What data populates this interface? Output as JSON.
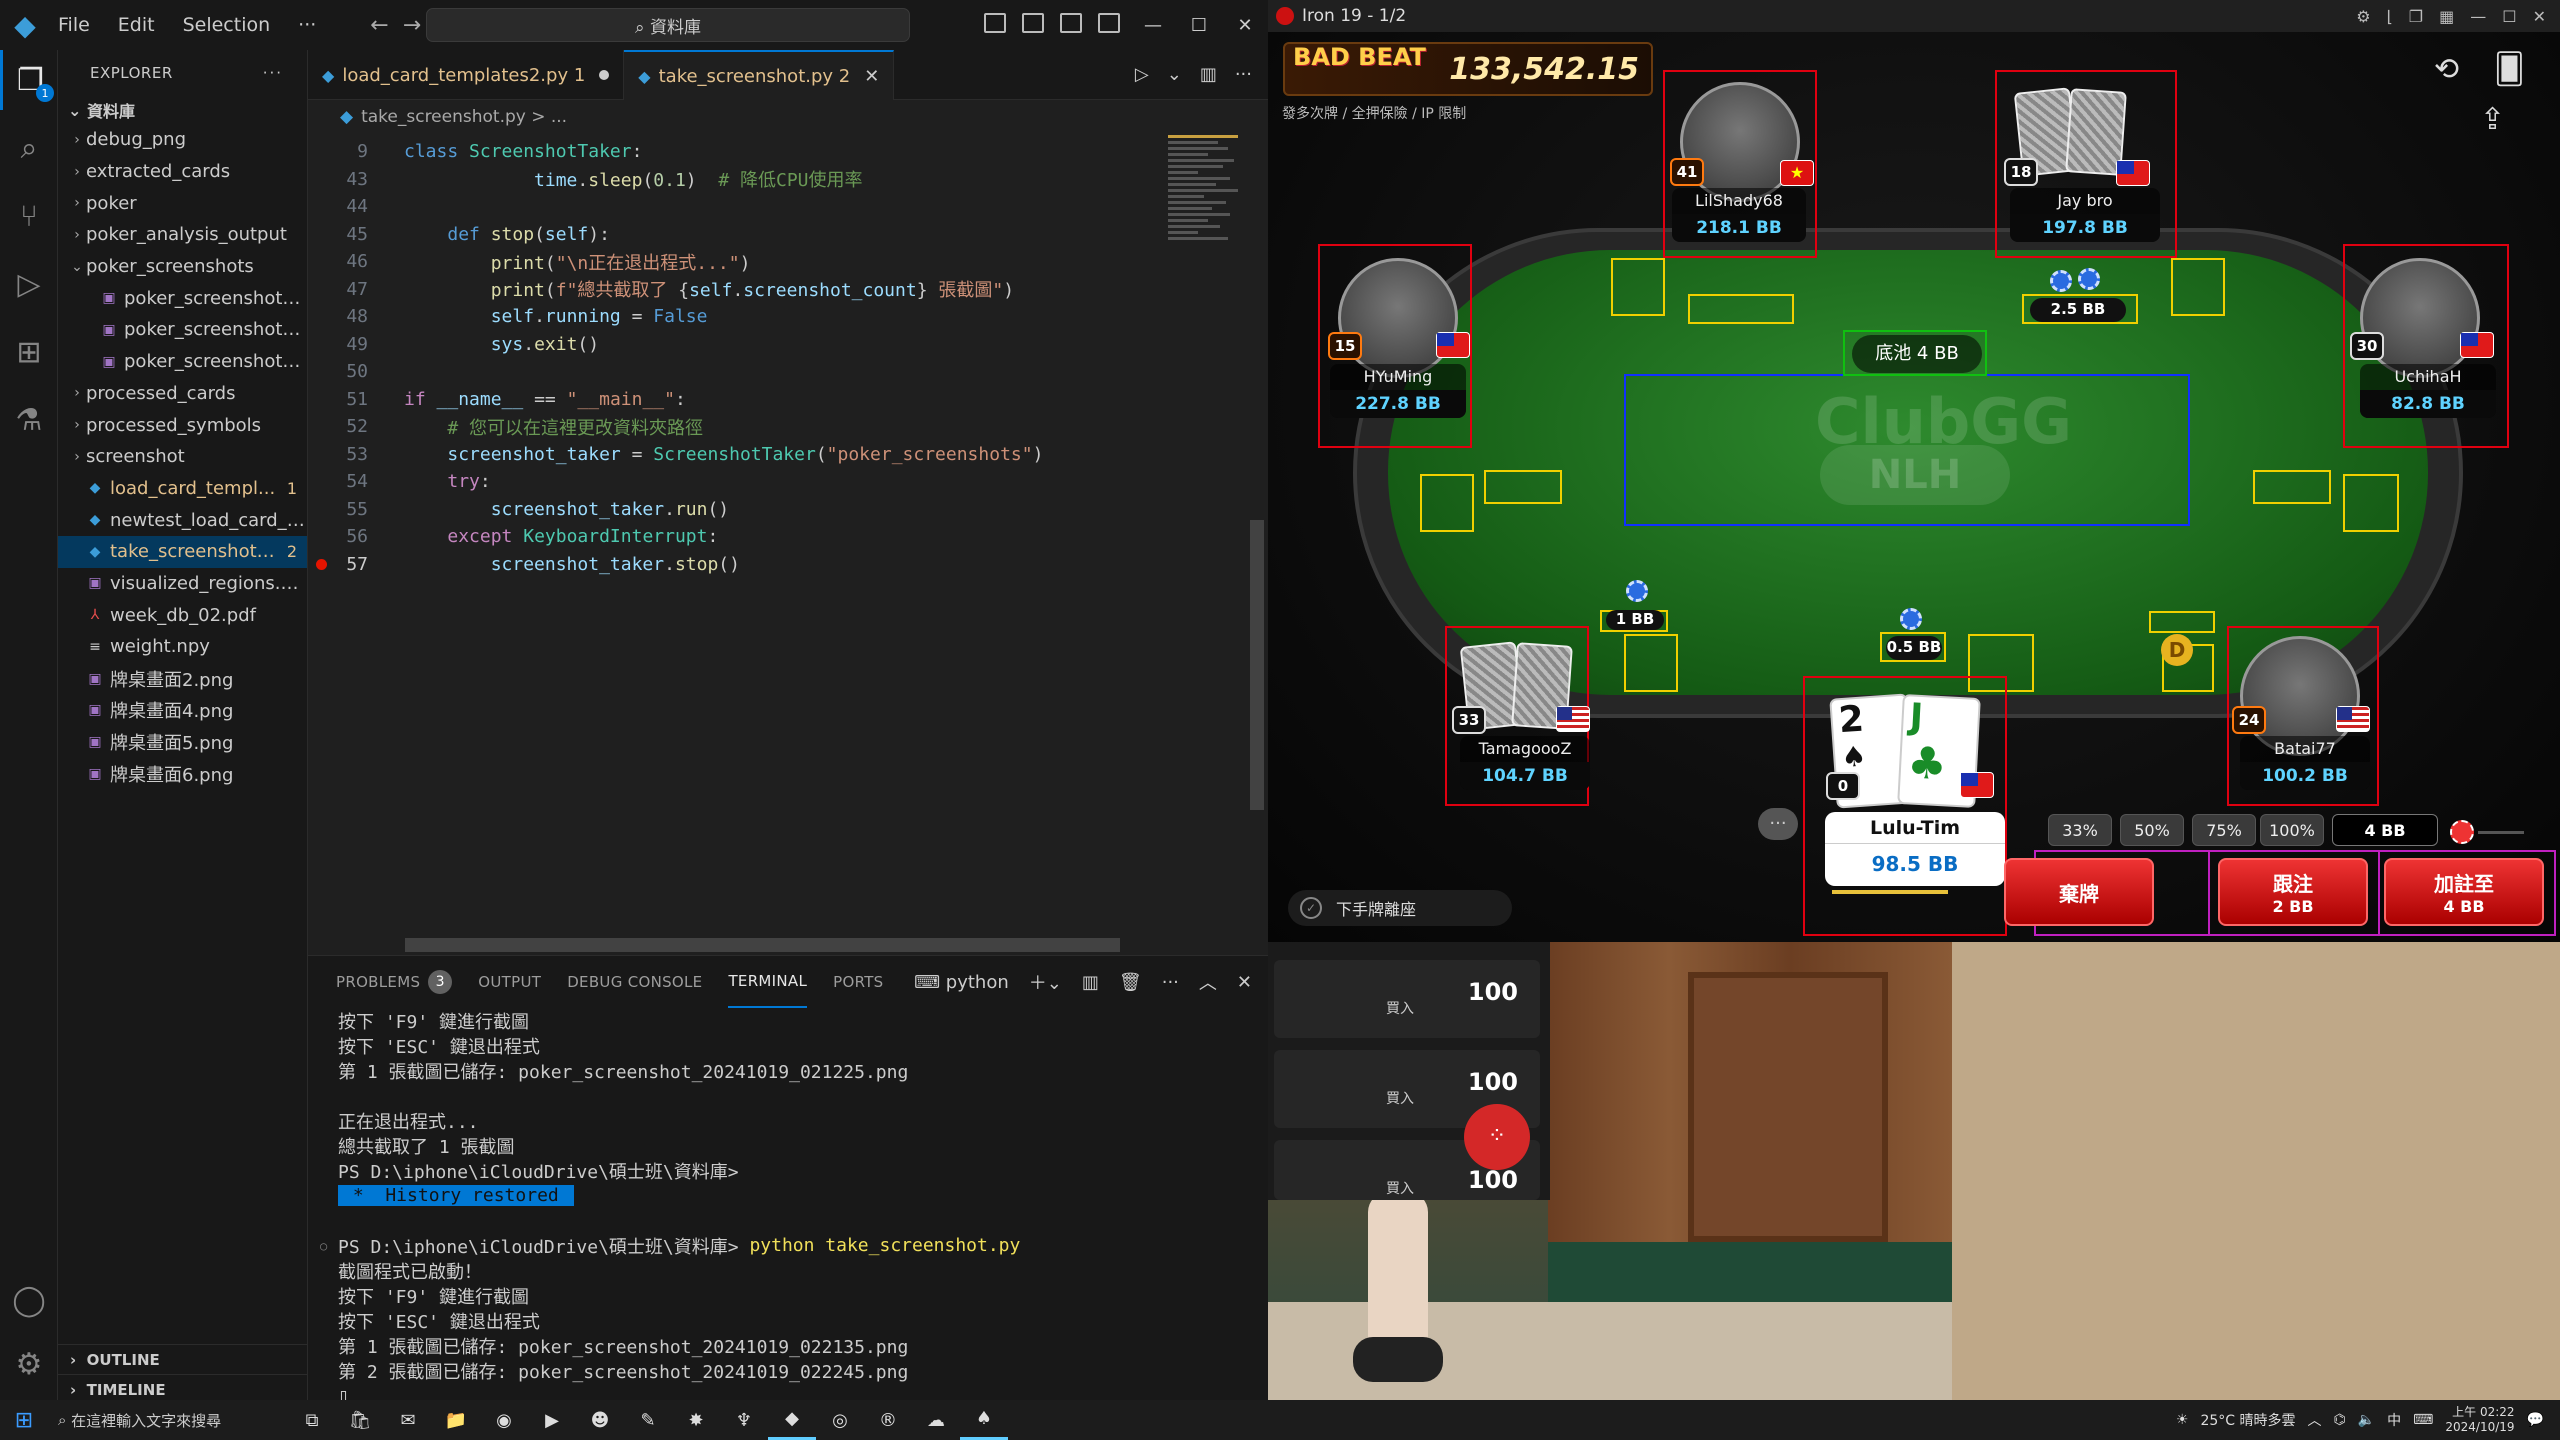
{
  "vscode": {
    "menu": [
      "File",
      "Edit",
      "Selection",
      "···"
    ],
    "command_center": "⌕ 資料庫",
    "explorer_title": "EXPLORER",
    "root_folder": "資料庫",
    "tree": [
      {
        "label": "debug_png",
        "type": "folder",
        "open": false
      },
      {
        "label": "extracted_cards",
        "type": "folder",
        "open": false
      },
      {
        "label": "poker",
        "type": "folder",
        "open": false
      },
      {
        "label": "poker_analysis_output",
        "type": "folder",
        "open": false
      },
      {
        "label": "poker_screenshots",
        "type": "folder",
        "open": true
      },
      {
        "label": "poker_screenshot_2...",
        "type": "image",
        "indent": 2
      },
      {
        "label": "poker_screenshot_2...",
        "type": "image",
        "indent": 2
      },
      {
        "label": "poker_screenshot_2...",
        "type": "image",
        "indent": 2
      },
      {
        "label": "processed_cards",
        "type": "folder",
        "open": false
      },
      {
        "label": "processed_symbols",
        "type": "folder",
        "open": false
      },
      {
        "label": "screenshot",
        "type": "folder",
        "open": false
      },
      {
        "label": "load_card_templ...",
        "type": "python",
        "count": "1",
        "status": "warn"
      },
      {
        "label": "newtest_load_card_te...",
        "type": "python"
      },
      {
        "label": "take_screenshot....",
        "type": "python",
        "count": "2",
        "status": "mod"
      },
      {
        "label": "visualized_regions.png",
        "type": "image"
      },
      {
        "label": "week_db_02.pdf",
        "type": "pdf"
      },
      {
        "label": "weight.npy",
        "type": "file"
      },
      {
        "label": "牌桌畫面2.png",
        "type": "image"
      },
      {
        "label": "牌桌畫面4.png",
        "type": "image"
      },
      {
        "label": "牌桌畫面5.png",
        "type": "image"
      },
      {
        "label": "牌桌畫面6.png",
        "type": "image"
      }
    ],
    "outline": "OUTLINE",
    "timeline": "TIMELINE",
    "tabs": [
      {
        "label": "load_card_templates2.py",
        "count": "1",
        "active": false
      },
      {
        "label": "take_screenshot.py",
        "count": "2",
        "active": true
      }
    ],
    "breadcrumb": "take_screenshot.py > ...",
    "code_lines": [
      {
        "n": "9",
        "html": "<span class='k'>class</span> <span class='cls'>ScreenshotTaker</span>:"
      },
      {
        "n": "43",
        "html": "            <span class='var'>time</span>.<span class='fn'>sleep</span>(<span class='num'>0.1</span>)  <span class='cmt'># 降低CPU使用率</span>"
      },
      {
        "n": "44",
        "html": ""
      },
      {
        "n": "45",
        "html": "    <span class='k'>def</span> <span class='fn'>stop</span>(<span class='var'>self</span>):"
      },
      {
        "n": "46",
        "html": "        <span class='fn'>print</span>(<span class='str'>\"\\n正在退出程式...\"</span>)"
      },
      {
        "n": "47",
        "html": "        <span class='fn'>print</span>(<span class='str'>f\"總共截取了 </span>{<span class='var'>self</span>.<span class='var'>screenshot_count</span>}<span class='str'> 張截圖\"</span>)"
      },
      {
        "n": "48",
        "html": "        <span class='var'>self</span>.<span class='var'>running</span> = <span class='cv'>False</span>"
      },
      {
        "n": "49",
        "html": "        <span class='var'>sys</span>.<span class='fn'>exit</span>()"
      },
      {
        "n": "50",
        "html": ""
      },
      {
        "n": "51",
        "html": "<span class='kp'>if</span> <span class='var'>__name__</span> == <span class='str'>\"__main__\"</span>:"
      },
      {
        "n": "52",
        "html": "    <span class='cmt'># 您可以在這裡更改資料夾路徑</span>"
      },
      {
        "n": "53",
        "html": "    <span class='var'>screenshot_taker</span> = <span class='cls'>ScreenshotTaker</span>(<span class='str'>\"poker_screenshots\"</span>)"
      },
      {
        "n": "54",
        "html": "    <span class='kp'>try</span>:"
      },
      {
        "n": "55",
        "html": "        <span class='var'>screenshot_taker</span>.<span class='fn'>run</span>()"
      },
      {
        "n": "56",
        "html": "    <span class='kp'>except</span> <span class='cls'>KeyboardInterrupt</span>:"
      },
      {
        "n": "57",
        "html": "        <span class='var'>screenshot_taker</span>.<span class='fn'>stop</span>()",
        "breakpoint": true,
        "current": true
      }
    ],
    "panel_tabs": [
      {
        "label": "PROBLEMS",
        "badge": "3"
      },
      {
        "label": "OUTPUT"
      },
      {
        "label": "DEBUG CONSOLE"
      },
      {
        "label": "TERMINAL",
        "active": true
      },
      {
        "label": "PORTS"
      }
    ],
    "terminal_profile": "python",
    "terminal_lines": [
      {
        "t": "按下 'F9' 鍵進行截圖"
      },
      {
        "t": "按下 'ESC' 鍵退出程式"
      },
      {
        "t": "第 1 張截圖已儲存: poker_screenshot_20241019_021225.png"
      },
      {
        "t": ""
      },
      {
        "t": "正在退出程式..."
      },
      {
        "t": "總共截取了 1 張截圖"
      },
      {
        "t": "PS D:\\iphone\\iCloudDrive\\碩士班\\資料庫>"
      },
      {
        "t": " *  History restored ",
        "hist": true
      },
      {
        "t": ""
      },
      {
        "t": "PS D:\\iphone\\iCloudDrive\\碩士班\\資料庫> ",
        "cmd": "python take_screenshot.py",
        "dot": true
      },
      {
        "t": "截圖程式已啟動！"
      },
      {
        "t": "按下 'F9' 鍵進行截圖"
      },
      {
        "t": "按下 'ESC' 鍵退出程式"
      },
      {
        "t": "第 1 張截圖已儲存: poker_screenshot_20241019_022135.png"
      },
      {
        "t": "第 2 張截圖已儲存: poker_screenshot_20241019_022245.png"
      },
      {
        "t": "▯"
      }
    ]
  },
  "poker": {
    "window_title": "Iron 19 - 1/2",
    "banner_brand": "BAD BEAT",
    "jackpot": "133,542.15",
    "game_sub": "發多次牌 / 全押保險 / IP 限制",
    "watermark": "ClubGG",
    "watermark_sub": "NLH",
    "pot_label": "底池 4 BB",
    "players": [
      {
        "name": "LilShady68",
        "stack": "218.1 BB",
        "level": "41",
        "flag": "vn"
      },
      {
        "name": "Jay bro",
        "stack": "197.8 BB",
        "level": "18",
        "flag": "tw"
      },
      {
        "name": "HYuMing",
        "stack": "227.8 BB",
        "level": "15",
        "flag": "tw"
      },
      {
        "name": "UchihaH",
        "stack": "82.8 BB",
        "level": "30",
        "flag": "tw"
      },
      {
        "name": "TamagoooZ",
        "stack": "104.7 BB",
        "level": "33",
        "flag": "us"
      },
      {
        "name": "Batai77",
        "stack": "100.2 BB",
        "level": "24",
        "flag": "us"
      }
    ],
    "hero": {
      "name": "Lulu-Tim",
      "stack": "98.5 BB",
      "level": "0",
      "cards": [
        "2",
        "J"
      ]
    },
    "bets": {
      "jay": "2.5 BB",
      "small": "1 BB",
      "big": "0.5 BB"
    },
    "dealer": "D",
    "presets": [
      "33%",
      "50%",
      "75%",
      "100%"
    ],
    "bet_value": "4 BB",
    "buttons": [
      {
        "label": "棄牌",
        "sub": ""
      },
      {
        "label": "跟注",
        "sub": "2 BB"
      },
      {
        "label": "加註至",
        "sub": "4 BB"
      }
    ],
    "sitout": "下手牌離座",
    "chat": "···"
  },
  "lobby": {
    "rows": [
      {
        "buy": "買入",
        "amount": "100"
      },
      {
        "buy": "買入",
        "amount": "100"
      },
      {
        "buy": "買入",
        "amount": "100"
      }
    ]
  },
  "taskbar": {
    "search": "在這裡輸入文字來搜尋",
    "weather": "25°C  晴時多雲",
    "ime": "中",
    "time": "上午 02:22",
    "date": "2024/10/19"
  }
}
